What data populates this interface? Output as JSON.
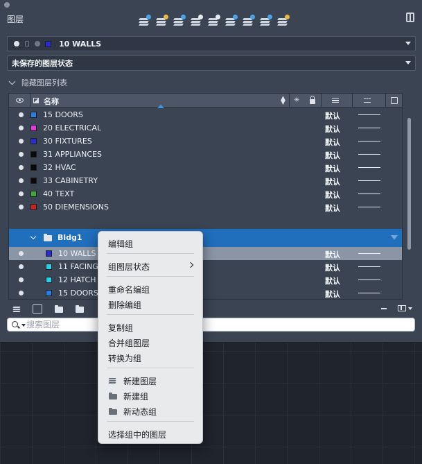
{
  "palette": {
    "title": "图层",
    "toolbar_icons": [
      "new-layer-icon",
      "delete-layer-icon",
      "new-vp-frozen-icon",
      "set-current-icon",
      "layer-states-icon",
      "freeze-icon",
      "isolate-icon",
      "lock-icon",
      "unlock-icon"
    ],
    "current_layer": {
      "name": "10 WALLS",
      "color": "#2b2bd6"
    },
    "layer_state": "未保存的图层状态",
    "hidden_list_label": "隐藏图层列表"
  },
  "grid": {
    "header": {
      "name": "名称"
    },
    "layers": [
      {
        "name": "15 DOORS",
        "color": "#2a7de1",
        "lineweight": "默认"
      },
      {
        "name": "20 ELECTRICAL",
        "color": "#e23ad8",
        "lineweight": "默认"
      },
      {
        "name": "30 FIXTURES",
        "color": "#2b2bd6",
        "lineweight": "默认"
      },
      {
        "name": "31 APPLIANCES",
        "color": "#0a0a0a",
        "lineweight": "默认"
      },
      {
        "name": "32 HVAC",
        "color": "#0a0a0a",
        "lineweight": "默认"
      },
      {
        "name": "33 CABINETRY",
        "color": "#0a0a0a",
        "lineweight": "默认"
      },
      {
        "name": "40 TEXT",
        "color": "#3fa83a",
        "lineweight": "默认"
      },
      {
        "name": "50 DIEMENSIONS",
        "color": "#c8231d",
        "lineweight": "默认"
      }
    ],
    "group": {
      "name": "Bldg1",
      "layers": [
        {
          "name": "10 WALLS",
          "color": "#2b2bd6",
          "lineweight": "默认",
          "selected": true
        },
        {
          "name": "11 FACING",
          "color": "#1fd4e6",
          "lineweight": "默认"
        },
        {
          "name": "12 HATCH",
          "color": "#1fd4e6",
          "lineweight": "默认"
        },
        {
          "name": "15 DOORS",
          "color": "#2a7de1",
          "lineweight": "默认"
        }
      ]
    },
    "scroll_position": 0.33
  },
  "search": {
    "placeholder": "搜索图层",
    "value": ""
  },
  "context_menu": {
    "edit_group": "编辑组",
    "group_layer_states": "组图层状态",
    "rename_group": "重命名编组",
    "delete_group": "删除编组",
    "duplicate_group": "复制组",
    "merge_group_layers": "合并组图层",
    "convert_to_group": "转换为组",
    "new_layer": "新建图层",
    "new_group": "新建组",
    "new_dynamic_group": "新动态组",
    "select_layers_in_group": "选择组中的图层"
  }
}
